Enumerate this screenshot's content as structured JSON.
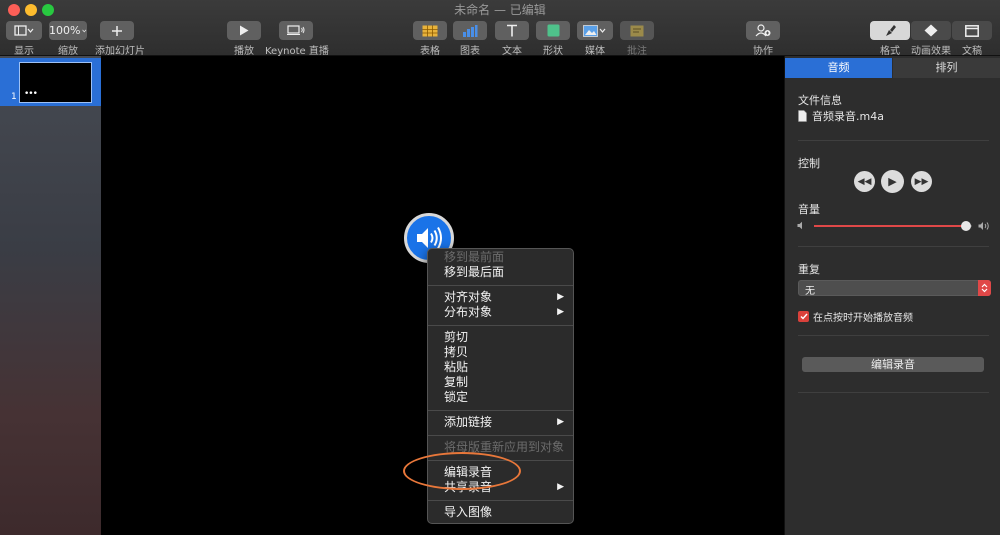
{
  "window": {
    "title": "未命名 — 已编辑"
  },
  "toolbar": {
    "view_label": "显示",
    "zoom_value": "100%",
    "zoom_label": "缩放",
    "add_slide_label": "添加幻灯片",
    "play_label": "播放",
    "keynote_live_label": "Keynote 直播",
    "table_label": "表格",
    "chart_label": "图表",
    "text_label": "文本",
    "shape_label": "形状",
    "media_label": "媒体",
    "comment_label": "批注",
    "collaborate_label": "协作",
    "format_label": "格式",
    "animate_label": "动画效果",
    "document_label": "文稿"
  },
  "navigator": {
    "slide_number": "1",
    "slide_dots": "•••"
  },
  "context_menu": {
    "items": [
      {
        "label": "移到最前面",
        "disabled": true
      },
      {
        "label": "移到最后面"
      },
      {
        "label": "对齐对象"
      },
      {
        "label": "分布对象"
      },
      {
        "label": "剪切"
      },
      {
        "label": "拷贝"
      },
      {
        "label": "粘贴"
      },
      {
        "label": "复制"
      },
      {
        "label": "锁定"
      },
      {
        "label": "添加链接"
      },
      {
        "label": "将母版重新应用到对象",
        "disabled": true
      },
      {
        "label": "编辑录音"
      },
      {
        "label": "共享录音"
      },
      {
        "label": "导入图像"
      }
    ]
  },
  "inspector": {
    "tabs": [
      {
        "label": "音频",
        "active": true
      },
      {
        "label": "排列"
      }
    ],
    "file_info_label": "文件信息",
    "file_name": "音频录音.m4a",
    "control_label": "控制",
    "volume_label": "音量",
    "volume_level": 0.96,
    "repeat_label": "重复",
    "repeat_value": "无",
    "start_on_click_label": "在点按时开始播放音频",
    "start_on_click_checked": true,
    "edit_recording_button": "编辑录音"
  },
  "colors": {
    "accent": "#2a6fd6",
    "highlight_oval": "#e8773a",
    "volume_track": "#e04848",
    "checkbox": "#d9413b"
  },
  "icons": [
    "view-icon",
    "zoom-chevron-icon",
    "plus-icon",
    "play-icon",
    "keynote-live-icon",
    "table-icon",
    "chart-icon",
    "text-icon",
    "shape-icon",
    "media-icon",
    "comment-icon",
    "collaborate-icon",
    "format-brush-icon",
    "animate-diamond-icon",
    "document-icon",
    "speaker-icon",
    "rewind-icon",
    "play-icon",
    "fast-forward-icon",
    "volume-low-icon",
    "volume-high-icon",
    "stepper-icon",
    "checkmark-icon",
    "file-icon",
    "submenu-arrow-icon"
  ]
}
